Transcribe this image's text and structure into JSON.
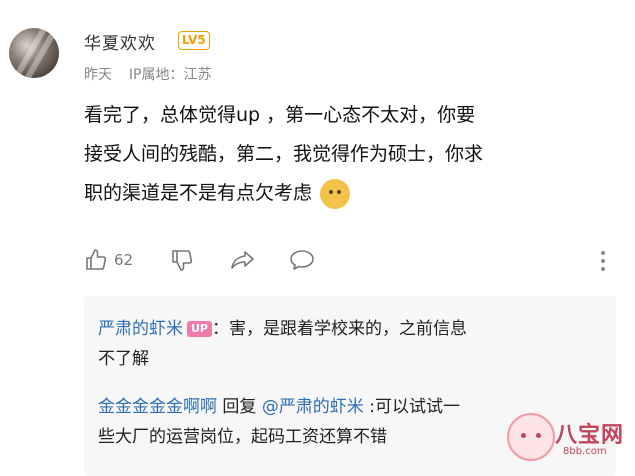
{
  "comment": {
    "username": "华夏欢欢",
    "level_badge": "LV5",
    "time": "昨天",
    "ip_location": "IP属地：江苏",
    "lines": [
      "看完了，总体觉得up ，第一心态不太对，你要",
      "接受人间的残酷，第二，我觉得作为硕士，你求",
      "职的渠道是不是有点欠考虑"
    ],
    "like_count": "62"
  },
  "replies": [
    {
      "author": "严肃的虾米",
      "badge": "UP",
      "text_line1": "：害，是跟着学校来的，之前信息",
      "text_line2": "不了解"
    },
    {
      "author": "金金金金金啊啊",
      "reply_word": " 回复 ",
      "mention": "@严肃的虾米",
      "text_line1": " :可以试试一",
      "text_line2": "些大厂的运营岗位，起码工资还算不错"
    }
  ],
  "watermark": {
    "text": "八宝网",
    "url": "8bb.com"
  },
  "colors": {
    "link": "#2f6fb4",
    "level": "#f0a000",
    "up_badge": "#f07aa8"
  }
}
